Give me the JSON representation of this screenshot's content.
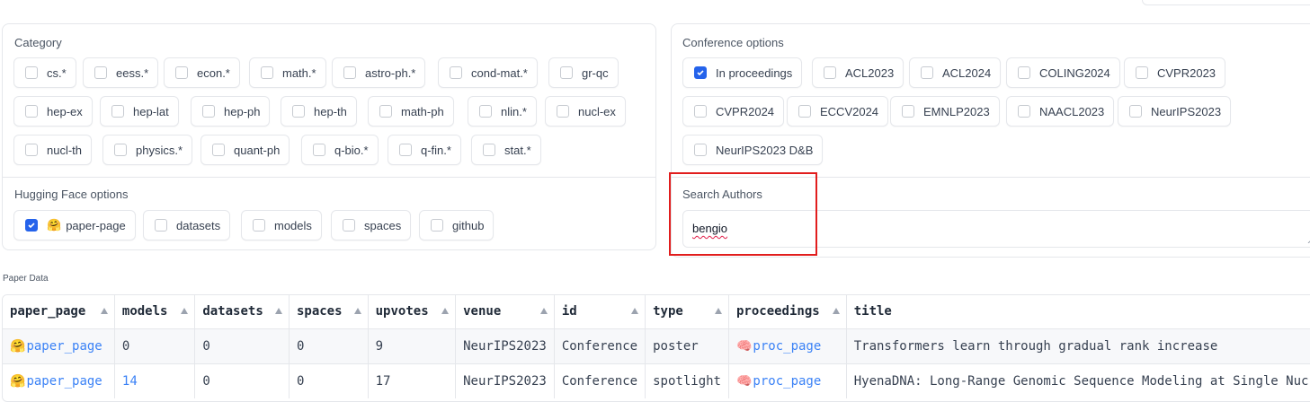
{
  "category": {
    "label": "Category",
    "options": [
      {
        "label": "cs.*",
        "checked": false
      },
      {
        "label": "eess.*",
        "checked": false
      },
      {
        "label": "econ.*",
        "checked": false
      },
      {
        "label": "math.*",
        "checked": false
      },
      {
        "label": "astro-ph.*",
        "checked": false
      },
      {
        "label": "cond-mat.*",
        "checked": false
      },
      {
        "label": "gr-qc",
        "checked": false
      },
      {
        "label": "hep-ex",
        "checked": false
      },
      {
        "label": "hep-lat",
        "checked": false
      },
      {
        "label": "hep-ph",
        "checked": false
      },
      {
        "label": "hep-th",
        "checked": false
      },
      {
        "label": "math-ph",
        "checked": false
      },
      {
        "label": "nlin.*",
        "checked": false
      },
      {
        "label": "nucl-ex",
        "checked": false
      },
      {
        "label": "nucl-th",
        "checked": false
      },
      {
        "label": "physics.*",
        "checked": false
      },
      {
        "label": "quant-ph",
        "checked": false
      },
      {
        "label": "q-bio.*",
        "checked": false
      },
      {
        "label": "q-fin.*",
        "checked": false
      },
      {
        "label": "stat.*",
        "checked": false
      }
    ]
  },
  "hf_options": {
    "label": "Hugging Face options",
    "options": [
      {
        "label": "paper-page",
        "checked": true,
        "emoji": "🤗"
      },
      {
        "label": "datasets",
        "checked": false
      },
      {
        "label": "models",
        "checked": false
      },
      {
        "label": "spaces",
        "checked": false
      },
      {
        "label": "github",
        "checked": false
      }
    ]
  },
  "conference": {
    "label": "Conference options",
    "options": [
      {
        "label": "In proceedings",
        "checked": true
      },
      {
        "label": "ACL2023",
        "checked": false
      },
      {
        "label": "ACL2024",
        "checked": false
      },
      {
        "label": "COLING2024",
        "checked": false
      },
      {
        "label": "CVPR2023",
        "checked": false
      },
      {
        "label": "CVPR2024",
        "checked": false
      },
      {
        "label": "ECCV2024",
        "checked": false
      },
      {
        "label": "EMNLP2023",
        "checked": false
      },
      {
        "label": "NAACL2023",
        "checked": false
      },
      {
        "label": "NeurIPS2023",
        "checked": false
      },
      {
        "label": "NeurIPS2023 D&B",
        "checked": false
      }
    ]
  },
  "search_authors": {
    "label": "Search Authors",
    "value": "bengio"
  },
  "paper_data": {
    "label": "Paper Data",
    "columns": [
      "paper_page",
      "models",
      "datasets",
      "spaces",
      "upvotes",
      "venue",
      "id",
      "type",
      "proceedings",
      "title"
    ],
    "rows": [
      {
        "paper_page": "paper_page",
        "paper_emoji": "🤗",
        "models": "0",
        "datasets": "0",
        "spaces": "0",
        "upvotes": "9",
        "venue": "NeurIPS2023",
        "id": "Conference",
        "type": "poster",
        "proceedings": "proc_page",
        "proc_emoji": "🧠",
        "title": "Transformers learn through gradual rank increase"
      },
      {
        "paper_page": "paper_page",
        "paper_emoji": "🤗",
        "models": "14",
        "datasets": "0",
        "spaces": "0",
        "upvotes": "17",
        "venue": "NeurIPS2023",
        "id": "Conference",
        "type": "spotlight",
        "proceedings": "proc_page",
        "proc_emoji": "🧠",
        "title": "HyenaDNA: Long-Range Genomic Sequence Modeling at Single Nuc"
      }
    ]
  },
  "colors": {
    "accent": "#2563eb",
    "link": "#3b82f6",
    "highlight": "#e11d1d"
  }
}
